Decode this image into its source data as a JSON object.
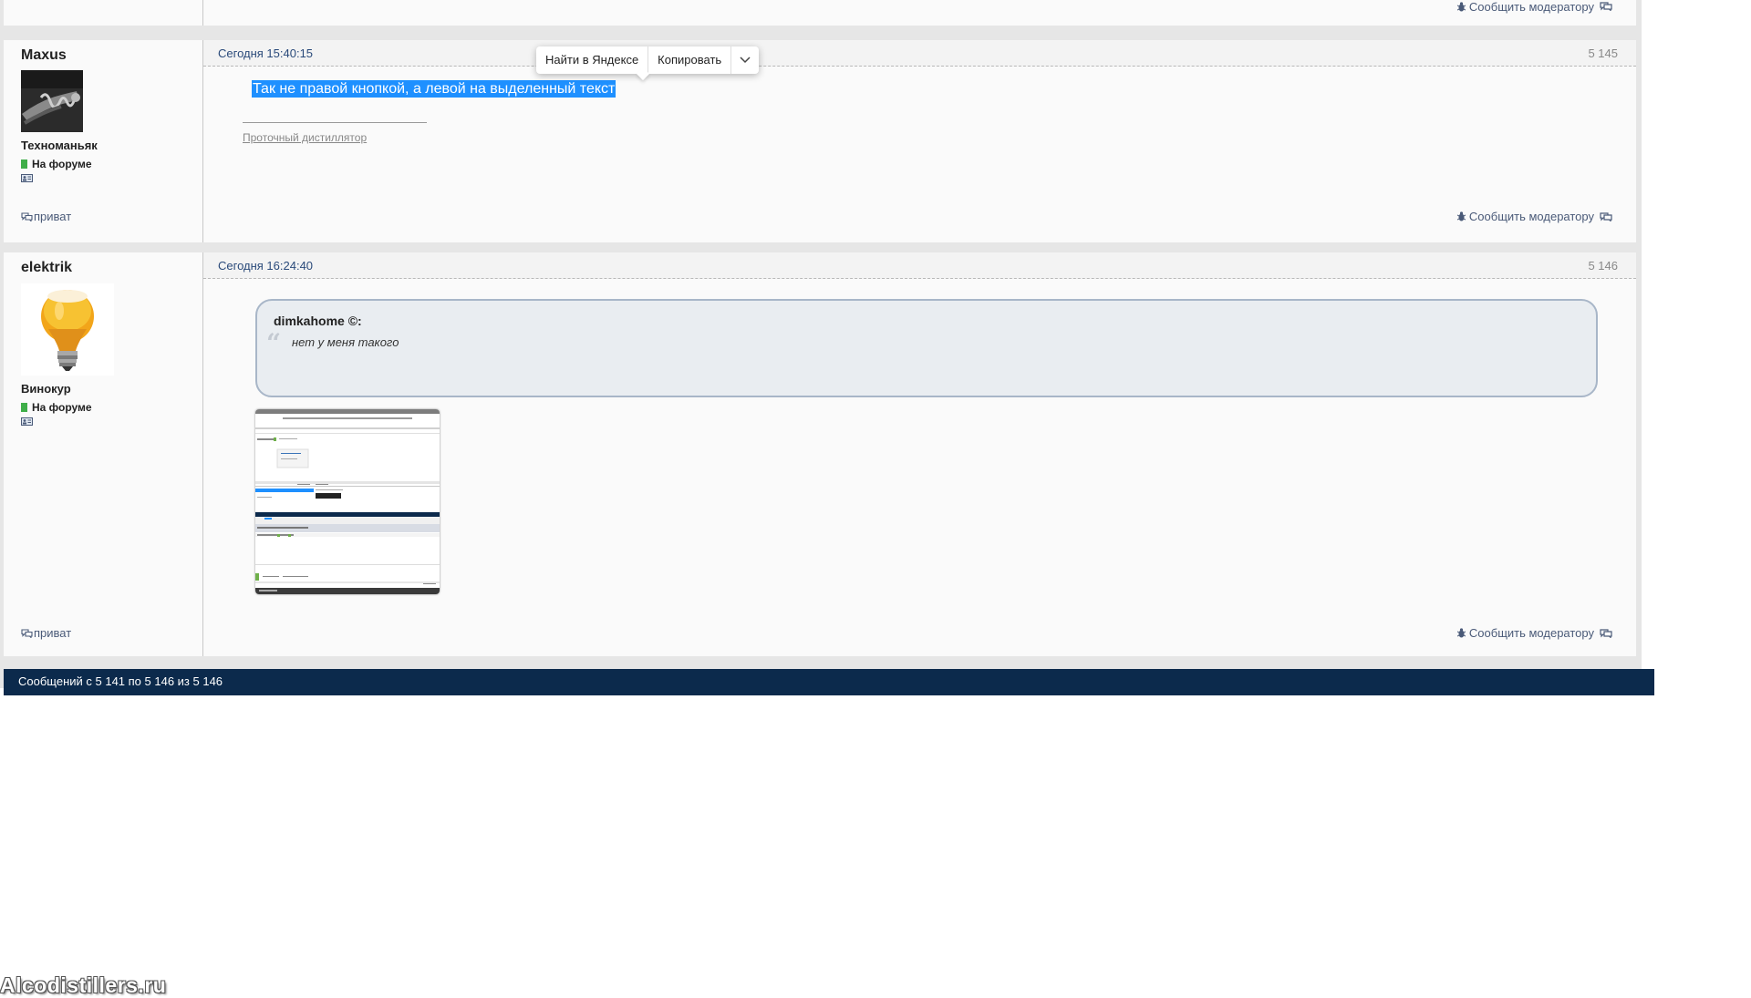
{
  "common": {
    "report_label": "Сообщить модератору",
    "pm_label": "приват",
    "online_label": "На форуме"
  },
  "posts": [
    {
      "author": "Maxus",
      "rank": "Техноманьяк",
      "date": "Сегодня 15:40:15",
      "number": "5 145",
      "selected_text": "Так не правой кнопкой, а левой на выделенный текст",
      "signature_link": "Проточный дистиллятор"
    },
    {
      "author": "elektrik",
      "rank": "Винокур",
      "date": "Сегодня 16:24:40",
      "number": "5 146",
      "quote_author": "dimkahome ©:",
      "quote_text": "нет у меня такого"
    }
  ],
  "context_menu": {
    "search_label": "Найти в Яндексе",
    "copy_label": "Копировать"
  },
  "status_bar": {
    "text": "Сообщений с 5 141 по 5 146 из 5 146"
  },
  "watermark": "Alcodistillers.ru",
  "colors": {
    "status_bar_bg": "#0c2a4c",
    "selection_bg": "#1e90ff",
    "online_dot": "#3fae49",
    "link": "#4a5a78"
  }
}
